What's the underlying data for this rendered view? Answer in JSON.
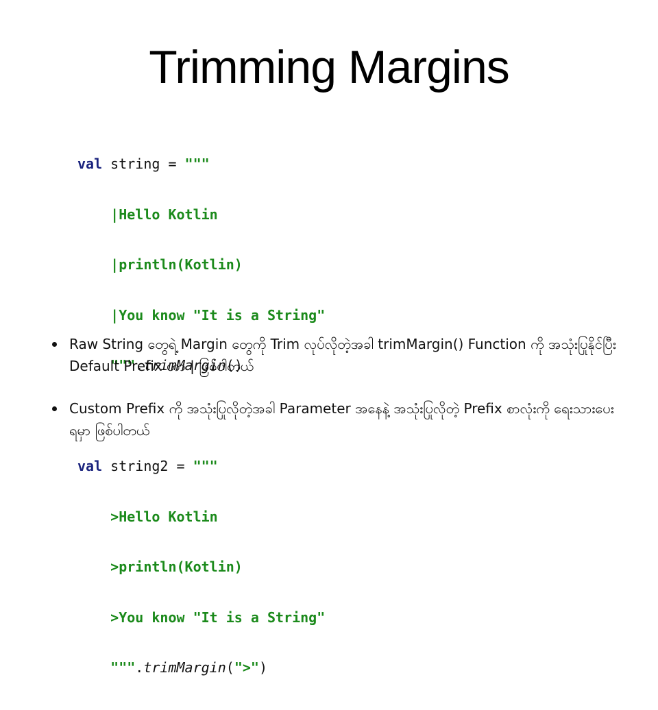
{
  "slide": {
    "title": "Trimming Margins",
    "code_block": {
      "example1": {
        "kw": "val",
        "decl": " string = ",
        "open_quotes": "\"\"\"",
        "lines": [
          "|Hello Kotlin",
          "|println(Kotlin)",
          "|You know \"It is a String\""
        ],
        "close_quotes": "\"\"\"",
        "dot": ".",
        "method": "trimMargin",
        "call_open": "(",
        "arg": "",
        "call_close": ")"
      },
      "example2": {
        "kw": "val",
        "decl": " string2 = ",
        "open_quotes": "\"\"\"",
        "lines": [
          ">Hello Kotlin",
          ">println(Kotlin)",
          ">You know \"It is a String\""
        ],
        "close_quotes": "\"\"\"",
        "dot": ".",
        "method": "trimMargin",
        "call_open": "(",
        "arg": "\">\"",
        "call_close": ")"
      }
    },
    "bullets": [
      "Raw String တွေရဲ့ Margin တွေကို Trim လုပ်လိုတဲ့အခါ trimMargin() Function ကို အသုံးပြုနိုင်ပြီး Default Prefix ဟာ | ဖြစ်ပါတယ်",
      "Custom Prefix ကို အသုံးပြုလိုတဲ့အခါ Parameter အနေနဲ့ အသုံးပြုလိုတဲ့ Prefix စာလုံးကို ရေးသားပေးရမှာ ဖြစ်ပါတယ်"
    ]
  },
  "colors": {
    "keyword": "#1a237e",
    "string": "#1b8a1b",
    "text": "#111111",
    "background": "#ffffff"
  }
}
